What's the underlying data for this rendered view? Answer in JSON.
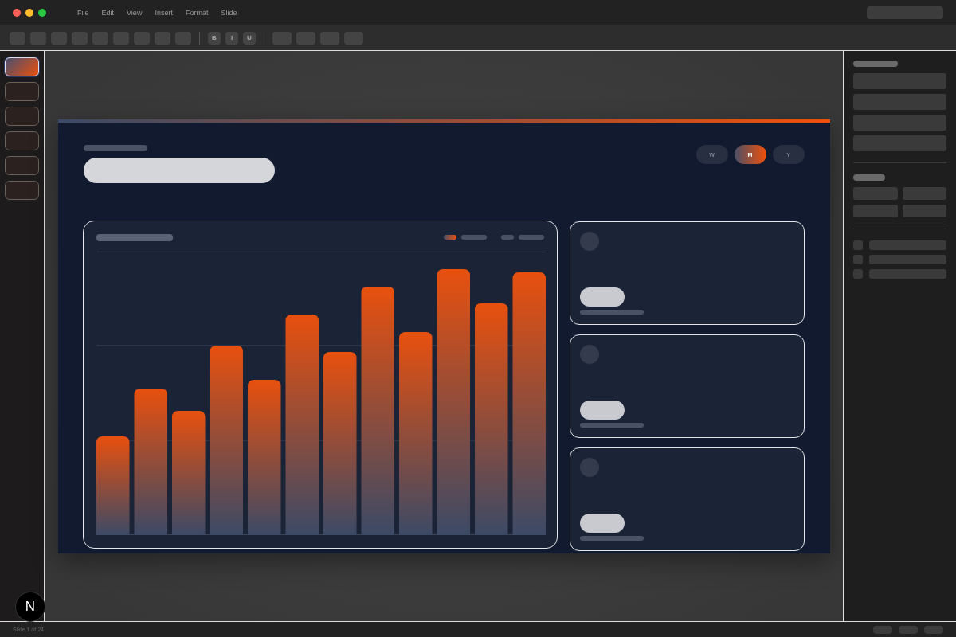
{
  "menu": [
    "File",
    "Edit",
    "View",
    "Insert",
    "Format",
    "Slide"
  ],
  "format_buttons": [
    "B",
    "I",
    "U"
  ],
  "slides": [
    {
      "selected": true
    },
    {
      "selected": false
    },
    {
      "selected": false
    },
    {
      "selected": false
    },
    {
      "selected": false
    },
    {
      "selected": false
    }
  ],
  "period_tabs": [
    {
      "label": "W",
      "selected": false
    },
    {
      "label": "M",
      "selected": true
    },
    {
      "label": "Y",
      "selected": false
    }
  ],
  "status_bar": {
    "text": "Slide 1 of 24"
  },
  "badge": {
    "letter": "N"
  }
}
